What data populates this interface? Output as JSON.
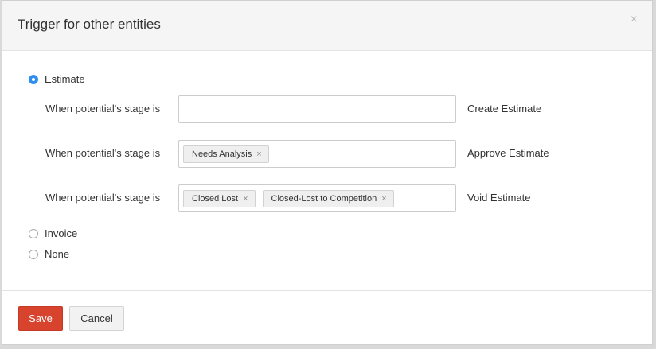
{
  "dialog": {
    "title": "Trigger for other entities",
    "close_glyph": "×"
  },
  "options": [
    {
      "label": "Estimate",
      "selected": true
    },
    {
      "label": "Invoice",
      "selected": false
    },
    {
      "label": "None",
      "selected": false
    }
  ],
  "rules": [
    {
      "condition": "When potential's stage is",
      "tags": [],
      "action": "Create Estimate"
    },
    {
      "condition": "When potential's stage is",
      "tags": [
        "Needs Analysis"
      ],
      "action": "Approve Estimate"
    },
    {
      "condition": "When potential's stage is",
      "tags": [
        "Closed Lost",
        "Closed-Lost to Competition"
      ],
      "action": "Void Estimate"
    }
  ],
  "tag_remove_glyph": "×",
  "footer": {
    "save_label": "Save",
    "cancel_label": "Cancel"
  },
  "colors": {
    "primary_button": "#d8432e",
    "radio_selected": "#2e8ff0"
  }
}
